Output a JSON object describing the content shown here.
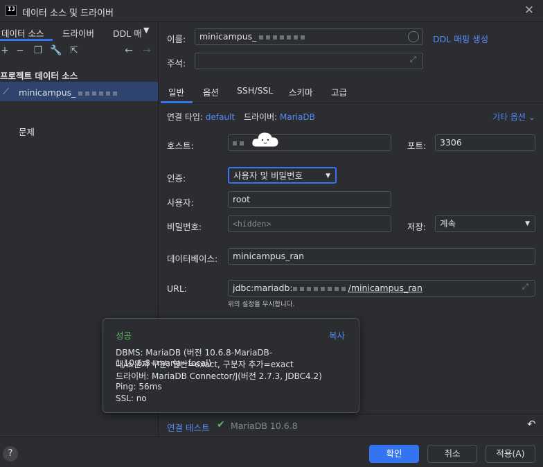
{
  "window": {
    "title": "데이터 소스 및 드라이버",
    "logo": "IJ"
  },
  "left": {
    "tabs": [
      "데이터 소스",
      "드라이버",
      "DDL 매"
    ],
    "toolbar": [
      "plus-icon",
      "minus-icon",
      "copy-icon",
      "wrench-icon",
      "export-icon",
      "back-arrow-icon",
      "forward-arrow-icon"
    ],
    "section": "프로젝트 데이터 소스",
    "datasource": "minicampus_",
    "problems": "문제"
  },
  "form": {
    "name_label": "이름:",
    "name_value": "minicampus_",
    "ddl_link": "DDL 매핑 생성",
    "comment_label": "주석:",
    "tabs": [
      "일반",
      "옵션",
      "SSH/SSL",
      "스키마",
      "고급"
    ],
    "conn_type_label": "연결 타입:",
    "conn_type_value": "default",
    "driver_label": "드라이버:",
    "driver_value": "MariaDB",
    "other_options": "기타 옵션",
    "host_label": "호스트:",
    "port_label": "포트:",
    "port_value": "3306",
    "auth_label": "인증:",
    "auth_value": "사용자 및 비밀번호",
    "user_label": "사용자:",
    "user_value": "root",
    "password_label": "비밀번호:",
    "password_placeholder": "<hidden>",
    "save_label": "저장:",
    "save_value": "계속",
    "database_label": "데이터베이스:",
    "database_value": "minicampus_ran",
    "url_label": "URL:",
    "url_prefix": "jdbc:mariadb:",
    "url_suffix": "/minicampus_ran",
    "url_hint": "위의 설정을 무시합니다."
  },
  "popup": {
    "title": "성공",
    "copy": "복사",
    "lines": [
      "DBMS: MariaDB (버전 10.6.8-MariaDB-1:10.6.8+maria~focal)",
      "대/소문자 구분: 일반=exact, 구분자 추가=exact",
      "드라이버: MariaDB Connector/J(버전 2.7.3, JDBC4.2)",
      "Ping: 56ms",
      "SSL: no"
    ]
  },
  "test": {
    "link": "연결 테스트",
    "result": "MariaDB 10.6.8"
  },
  "buttons": {
    "ok": "확인",
    "cancel": "취소",
    "apply": "적용(A)",
    "help": "?"
  },
  "colors": {
    "accent": "#3574f0",
    "link": "#548af7",
    "success": "#5fb865",
    "selection": "#2e436e"
  }
}
